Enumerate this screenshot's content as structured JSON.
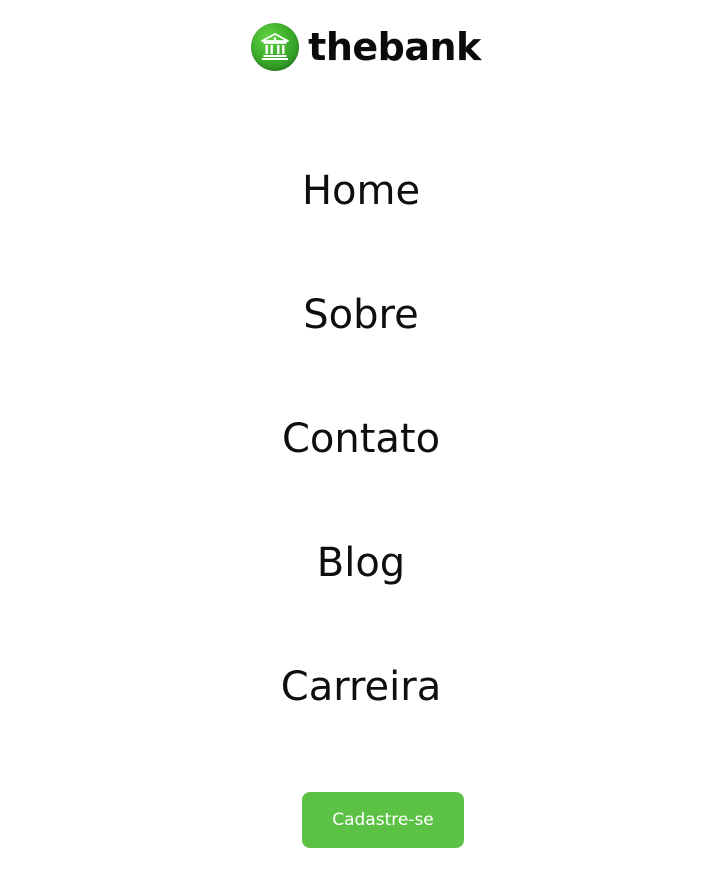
{
  "header": {
    "brand": "thebank",
    "logo_icon": "bank-building-icon",
    "brand_color": "#3fae2d"
  },
  "nav": {
    "items": [
      {
        "label": "Home"
      },
      {
        "label": "Sobre"
      },
      {
        "label": "Contato"
      },
      {
        "label": "Blog"
      },
      {
        "label": "Carreira"
      }
    ]
  },
  "cta": {
    "label": "Cadastre-se",
    "color": "#5cc246"
  }
}
